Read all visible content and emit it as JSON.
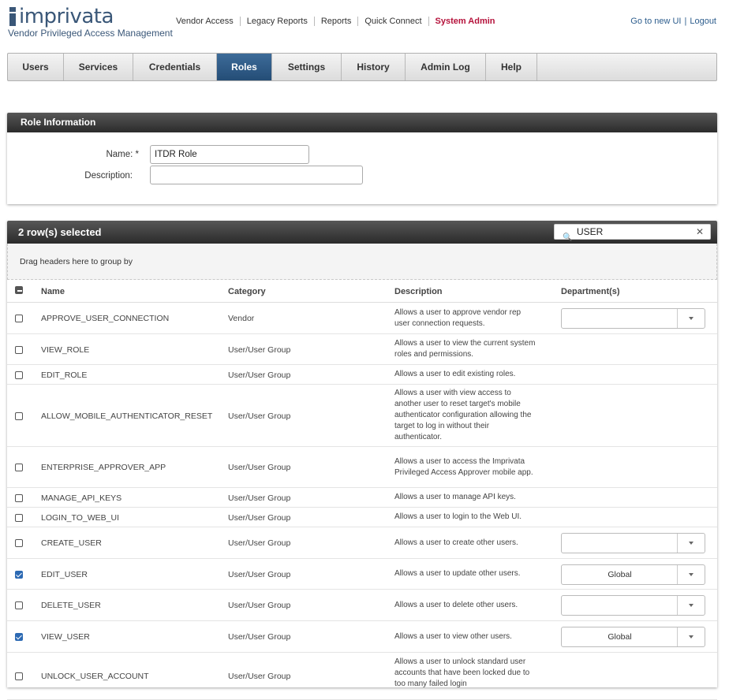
{
  "app": {
    "logo_word": "imprivata",
    "logo_sub": "Vendor Privileged Access Management"
  },
  "topnav": [
    {
      "label": "Vendor Access"
    },
    {
      "label": "Legacy Reports"
    },
    {
      "label": "Reports"
    },
    {
      "label": "Quick Connect"
    },
    {
      "label": "System Admin",
      "active": true
    }
  ],
  "toplinks": {
    "new_ui": "Go to new UI",
    "separator": "|",
    "logout": "Logout"
  },
  "tabs": [
    {
      "label": "Users"
    },
    {
      "label": "Services"
    },
    {
      "label": "Credentials"
    },
    {
      "label": "Roles",
      "active": true
    },
    {
      "label": "Settings"
    },
    {
      "label": "History"
    },
    {
      "label": "Admin Log"
    },
    {
      "label": "Help"
    }
  ],
  "role_info": {
    "title": "Role Information",
    "name_label": "Name: *",
    "name_value": "ITDR Role",
    "description_label": "Description:",
    "description_value": ""
  },
  "grid": {
    "selected_text": "2 row(s) selected",
    "search_value": "USER",
    "group_hint": "Drag headers here to group by",
    "columns": {
      "name": "Name",
      "category": "Category",
      "description": "Description",
      "departments": "Department(s)"
    },
    "rows": [
      {
        "name": "APPROVE_USER_CONNECTION",
        "category": "Vendor",
        "description": "Allows a user to approve vendor rep user connection requests.",
        "checked": false,
        "dept": ""
      },
      {
        "name": "VIEW_ROLE",
        "category": "User/User Group",
        "description": "Allows a user to view the current system roles and permissions.",
        "checked": false
      },
      {
        "name": "EDIT_ROLE",
        "category": "User/User Group",
        "description": "Allows a user to edit existing roles.",
        "checked": false
      },
      {
        "name": "ALLOW_MOBILE_AUTHENTICATOR_RESET",
        "category": "User/User Group",
        "description": "Allows a user with view access to another user to reset target's mobile authenticator configuration allowing the target to log in without their authenticator.",
        "checked": false
      },
      {
        "name": "ENTERPRISE_APPROVER_APP",
        "category": "User/User Group",
        "description": "Allows a user to access the Imprivata Privileged Access Approver mobile app.",
        "checked": false
      },
      {
        "name": "MANAGE_API_KEYS",
        "category": "User/User Group",
        "description": "Allows a user to manage API keys.",
        "checked": false
      },
      {
        "name": "LOGIN_TO_WEB_UI",
        "category": "User/User Group",
        "description": "Allows a user to login to the Web UI.",
        "checked": false
      },
      {
        "name": "CREATE_USER",
        "category": "User/User Group",
        "description": "Allows a user to create other users.",
        "checked": false,
        "dept": ""
      },
      {
        "name": "EDIT_USER",
        "category": "User/User Group",
        "description": "Allows a user to update other users.",
        "checked": true,
        "dept": "Global"
      },
      {
        "name": "DELETE_USER",
        "category": "User/User Group",
        "description": "Allows a user to delete other users.",
        "checked": false,
        "dept": ""
      },
      {
        "name": "VIEW_USER",
        "category": "User/User Group",
        "description": "Allows a user to view other users.",
        "checked": true,
        "dept": "Global"
      },
      {
        "name": "UNLOCK_USER_ACCOUNT",
        "category": "User/User Group",
        "description": "Allows a user to unlock standard user accounts that have been locked due to too many failed login",
        "checked": false
      }
    ]
  },
  "colors": {
    "accent": "#b5123b",
    "tab_active": "#2f5b87",
    "link": "#2d5d8d",
    "checkbox": "#2d6ab3"
  }
}
